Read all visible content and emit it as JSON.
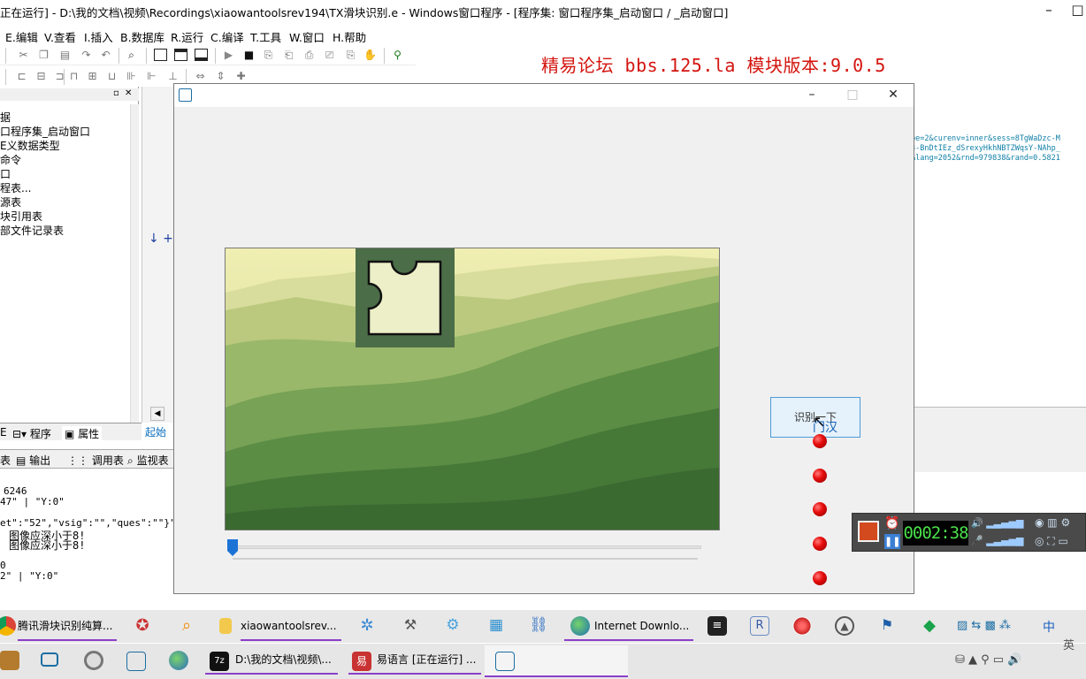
{
  "window": {
    "title": "正在运行] - D:\\我的文档\\视频\\Recordings\\xiaowantoolsrev194\\TX滑块识别.e - Windows窗口程序 - [程序集: 窗口程序集_启动窗口 / _启动窗口]",
    "minimize": "–",
    "maximize": "□",
    "close": "✕"
  },
  "menu": [
    "E.编辑",
    "V.查看",
    "I.插入",
    "B.数据库",
    "R.运行",
    "C.编译",
    "T.工具",
    "W.窗口",
    "H.帮助"
  ],
  "brand": "精易论坛 bbs.125.la 模块版本:9.0.5",
  "left_panel": {
    "tree": [
      "据",
      "口程序集_启动窗口",
      "E义数据类型",
      "命令",
      "口",
      "程表...",
      "源表",
      "块引用表",
      "部文件记录表"
    ],
    "tabs": [
      "程序",
      "属性"
    ],
    "first_tab_fragment": "E"
  },
  "editor": {
    "start_tab": "起始"
  },
  "output": {
    "tabs": [
      "输出",
      "调用表",
      "监视表"
    ],
    "first_fragment": "表",
    "lines": [
      "6246",
      "47\" | \"Y:0\"",
      "et\":\"52\",\"vsig\":\"\",\"ques\":\"\"}\"",
      "图像应深小于8!",
      "图像应深小于8!",
      "0",
      "2\" | \"Y:0\""
    ]
  },
  "code_right": [
    "pe=2&curenv=inner&sess=8TgWaDzc-M",
    "3-BnDtIEz_dSrexyHkhNBTZWqsY-NAhp_",
    "&lang=2052&rnd=979838&rand=0.5821"
  ],
  "dialog": {
    "recognize_button": "识别一下",
    "ime_text": "门汉",
    "slider_value": 0,
    "indicator_count": 5
  },
  "recorder": {
    "time": "0002:38"
  },
  "taskbar_top": {
    "items": [
      {
        "label": "腾讯滑块识别纯算..."
      },
      {
        "label": "xiaowantoolsrev..."
      },
      {
        "label": "Internet Downlo..."
      }
    ],
    "ime_lang": "中"
  },
  "taskbar_bottom": {
    "items": [
      {
        "label": "D:\\我的文档\\视频\\..."
      },
      {
        "label": "易语言 [正在运行] ..."
      }
    ],
    "corner": "英"
  },
  "colors": {
    "brand_red": "#d4140e",
    "accent_blue": "#0b6fc0",
    "taskbar_underline": "#8b3fc9",
    "slider_thumb": "#1c73d6",
    "indicator_red": "#e80d0d"
  }
}
